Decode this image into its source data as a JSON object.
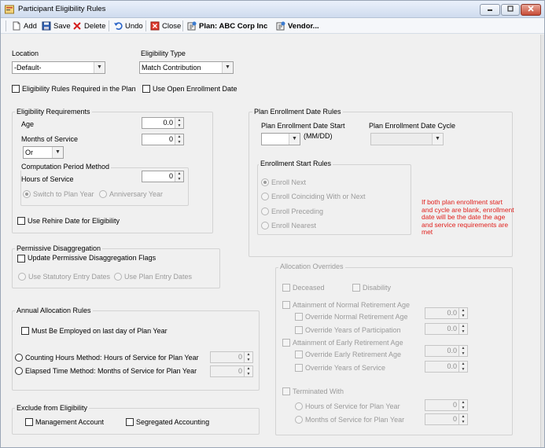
{
  "window": {
    "title": "Participant Eligibility Rules"
  },
  "toolbar": {
    "add": "Add",
    "save": "Save",
    "delete": "Delete",
    "undo": "Undo",
    "close": "Close",
    "plan": "Plan: ABC Corp Inc",
    "vendor": "Vendor..."
  },
  "top": {
    "location_label": "Location",
    "location_value": "-Default-",
    "type_label": "Eligibility Type",
    "type_value": "Match Contribution",
    "rules_required": "Eligibility Rules Required in the Plan",
    "open_enrollment": "Use Open Enrollment Date"
  },
  "elig": {
    "title": "Eligibility Requirements",
    "age_label": "Age",
    "age_value": "0.0",
    "months_label": "Months of Service",
    "months_value": "0",
    "or_value": "Or",
    "comp_title": "Computation Period Method",
    "hours_label": "Hours of Service",
    "hours_value": "0",
    "switch": "Switch to Plan Year",
    "anniversary": "Anniversary Year",
    "rehire": "Use Rehire Date for Eligibility"
  },
  "perm": {
    "title": "Permissive Disaggregation",
    "update": "Update Permissive Disaggregation Flags",
    "statutory": "Use Statutory Entry Dates",
    "plan_entry": "Use Plan Entry Dates"
  },
  "annual": {
    "title": "Annual Allocation Rules",
    "employed": "Must Be Employed on last day of Plan Year",
    "counting": "Counting Hours Method:  Hours of Service for Plan Year",
    "counting_value": "0",
    "elapsed": "Elapsed Time Method: Months of Service for Plan Year",
    "elapsed_value": "0"
  },
  "exclude": {
    "title": "Exclude from Eligibility",
    "management": "Management Account",
    "segregated": "Segregated Accounting"
  },
  "enroll": {
    "title": "Plan Enrollment Date Rules",
    "start_label": "Plan Enrollment Date Start",
    "mmdd": "(MM/DD)",
    "cycle_label": "Plan Enrollment Date Cycle",
    "start_rules_title": "Enrollment Start Rules",
    "enroll_next": "Enroll Next",
    "coinciding": "Enroll Coinciding With or Next",
    "preceding": "Enroll Preceding",
    "nearest": "Enroll Nearest",
    "note": "If both plan enrollment start and cycle are blank, enrollment date will be the date the age and service requirements are met"
  },
  "alloc": {
    "title": "Allocation Overrides",
    "deceased": "Deceased",
    "disability": "Disability",
    "normal": "Attainment of Normal Retirement Age",
    "override_normal": "Override Normal Retirement Age",
    "override_normal_value": "0.0",
    "override_years": "Override Years of Participation",
    "override_years_value": "0.0",
    "early": "Attainment of Early Retirement Age",
    "override_early": "Override Early Retirement Age",
    "override_early_value": "0.0",
    "override_service": "Override Years of Service",
    "override_service_value": "0.0",
    "terminated": "Terminated With",
    "hours_plan": "Hours of Service for Plan Year",
    "hours_plan_value": "0",
    "months_plan": "Months of Service for Plan Year",
    "months_plan_value": "0"
  },
  "colors": {
    "note": "#e0201c",
    "disabled": "#9a9a9a"
  }
}
